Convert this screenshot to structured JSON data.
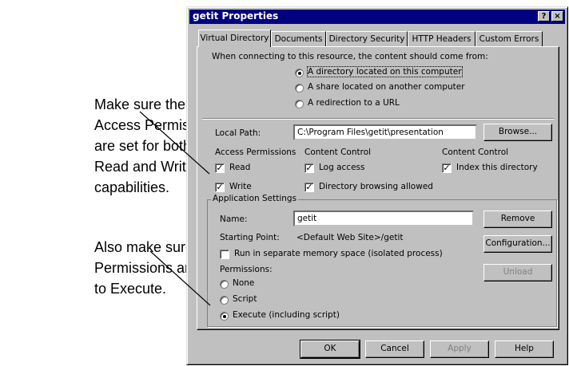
{
  "callouts": [
    "Make sure the\nAccess Permissions\nare set for both\nRead and Write\ncapabilities.",
    "Also make sure the\nPermissions are set\nto Execute."
  ],
  "dialog": {
    "title": "getit Properties",
    "help_button": "?",
    "close_button": "×",
    "tabs": [
      "Virtual Directory",
      "Documents",
      "Directory Security",
      "HTTP Headers",
      "Custom Errors"
    ],
    "connection_prompt": "When connecting to this resource, the content should come from:",
    "source_options": [
      {
        "label": "A directory located on this computer",
        "selected": true
      },
      {
        "label": "A share located on another computer",
        "selected": false
      },
      {
        "label": "A redirection to a URL",
        "selected": false
      }
    ],
    "local_path_label": "Local Path:",
    "local_path_value": "C:\\Program Files\\getit\\presentation",
    "browse_button": "Browse...",
    "access_permissions_header": "Access Permissions",
    "content_control_header": "Content Control",
    "content_control_header_2": "Content Control",
    "read_label": "Read",
    "read_checked": true,
    "write_label": "Write",
    "write_checked": true,
    "log_access_label": "Log access",
    "log_access_checked": true,
    "dir_browsing_label": "Directory browsing allowed",
    "dir_browsing_checked": true,
    "index_label": "Index this directory",
    "index_checked": true,
    "app_settings_header": "Application Settings",
    "name_label": "Name:",
    "name_value": "getit",
    "remove_button": "Remove",
    "starting_point_label": "Starting Point:",
    "starting_point_value": "<Default Web Site>/getit",
    "configuration_button": "Configuration...",
    "separate_memory_label": "Run in separate memory space (isolated process)",
    "separate_memory_checked": false,
    "unload_button": "Unload",
    "permissions_label": "Permissions:",
    "permission_options": [
      {
        "label": "None",
        "selected": false
      },
      {
        "label": "Script",
        "selected": false
      },
      {
        "label": "Execute (including script)",
        "selected": true
      }
    ],
    "ok_button": "OK",
    "cancel_button": "Cancel",
    "apply_button": "Apply",
    "help_bottom_button": "Help"
  }
}
